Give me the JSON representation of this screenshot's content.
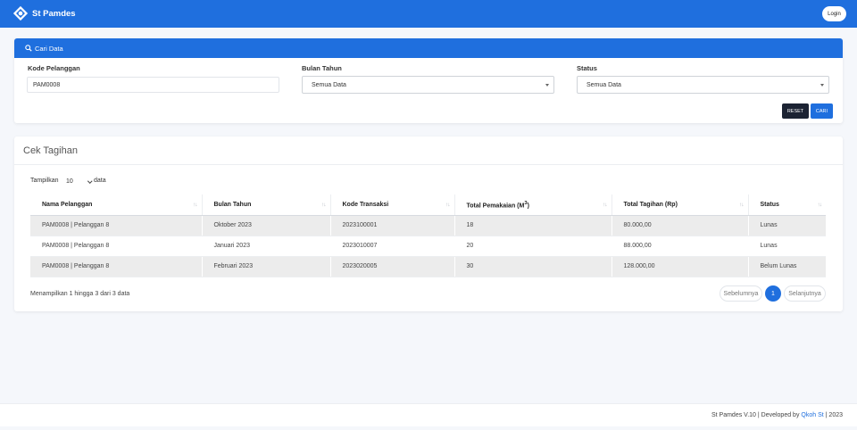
{
  "header": {
    "brand": "St Pamdes",
    "login_label": "Login",
    "accent_color": "#1f6fde"
  },
  "search_card": {
    "title": "Cari Data",
    "fields": {
      "kode_label": "Kode Pelanggan",
      "kode_value": "PAM0008",
      "bulan_label": "Bulan Tahun",
      "bulan_value": "Semua Data",
      "status_label": "Status",
      "status_value": "Semua Data"
    },
    "reset_label": "RESET",
    "cari_label": "CARI"
  },
  "tagihan": {
    "title": "Cek Tagihan",
    "length": {
      "prefix": "Tampilkan",
      "value": "10",
      "suffix": "data"
    },
    "columns": [
      "Nama Pelanggan",
      "Bulan Tahun",
      "Kode Transaksi",
      "Total Pemakaian (M",
      "Total Tagihan (Rp)",
      "Status"
    ],
    "columns_sup": "3",
    "rows": [
      [
        "PAM0008 | Pelanggan 8",
        "Oktober 2023",
        "2023100001",
        "18",
        "80.000,00",
        "Lunas"
      ],
      [
        "PAM0008 | Pelanggan 8",
        "Januari 2023",
        "2023010007",
        "20",
        "88.000,00",
        "Lunas"
      ],
      [
        "PAM0008 | Pelanggan 8",
        "Februari 2023",
        "2023020005",
        "30",
        "128.000,00",
        "Belum Lunas"
      ]
    ],
    "info": "Menampilkan 1 hingga 3 dari 3 data",
    "pagination": {
      "prev": "Sebelumnya",
      "current": "1",
      "next": "Selanjutnya"
    }
  },
  "footer": {
    "prefix": "St Pamdes V.10 | Developed by",
    "link": "Qkoh St",
    "suffix": "| 2023"
  }
}
